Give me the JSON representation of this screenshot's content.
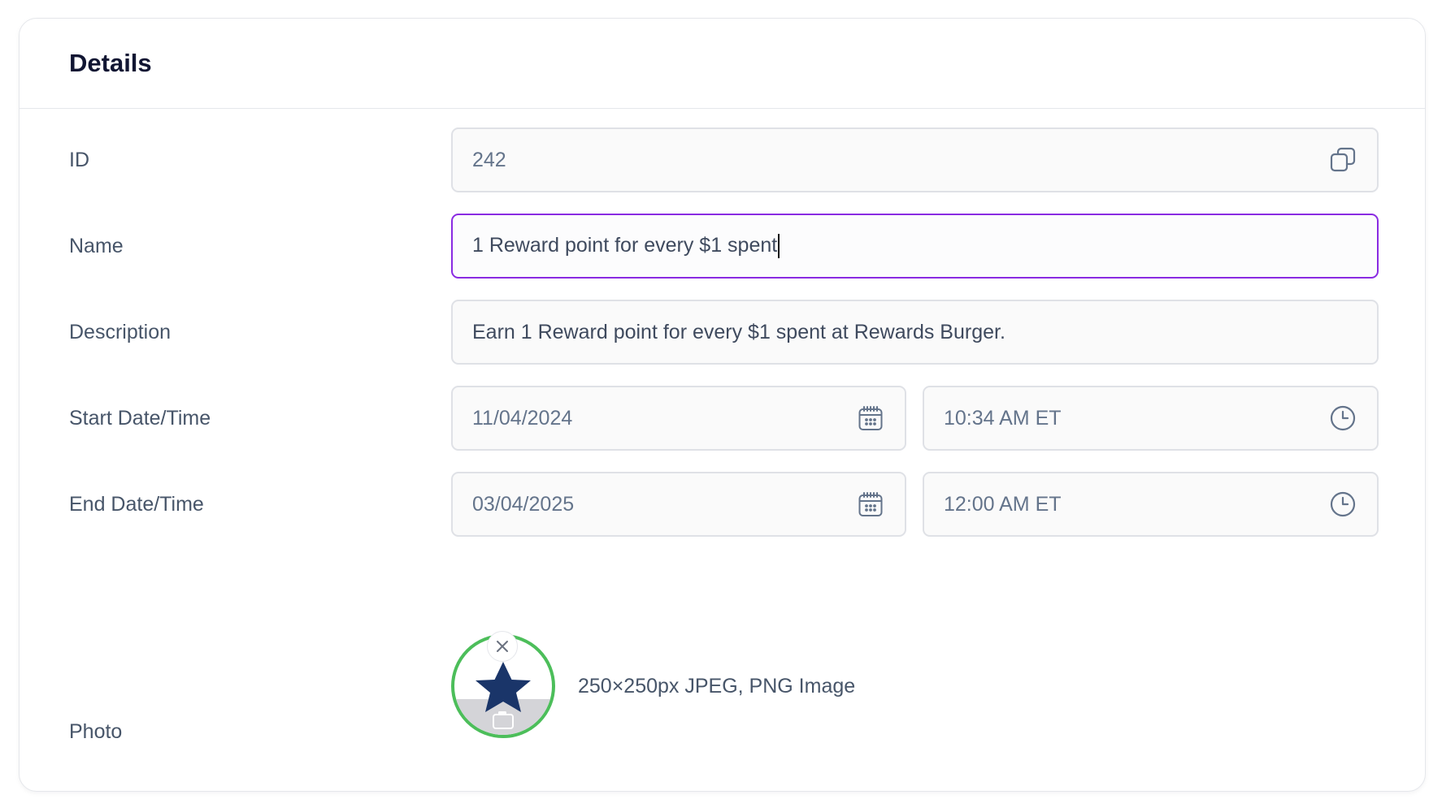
{
  "card": {
    "title": "Details"
  },
  "fields": {
    "id": {
      "label": "ID",
      "value": "242",
      "icon": "copy-icon"
    },
    "name": {
      "label": "Name",
      "value": "1 Reward point for every $1 spent"
    },
    "description": {
      "label": "Description",
      "value": "Earn 1 Reward point for every $1 spent at Rewards Burger."
    },
    "start": {
      "label": "Start Date/Time",
      "date": "11/04/2024",
      "time": "10:34 AM ET",
      "date_icon": "calendar-icon",
      "time_icon": "clock-icon"
    },
    "end": {
      "label": "End Date/Time",
      "date": "03/04/2025",
      "time": "12:00 AM ET",
      "date_icon": "calendar-icon",
      "time_icon": "clock-icon"
    },
    "photo": {
      "label": "Photo",
      "hint": "250×250px JPEG, PNG Image",
      "image_icon": "star-icon",
      "remove_icon": "close-icon",
      "upload_icon": "camera-icon"
    }
  },
  "colors": {
    "focus_border": "#8a2be2",
    "photo_ring": "#4cbe5a",
    "star": "#1a3569",
    "title": "#111633"
  }
}
